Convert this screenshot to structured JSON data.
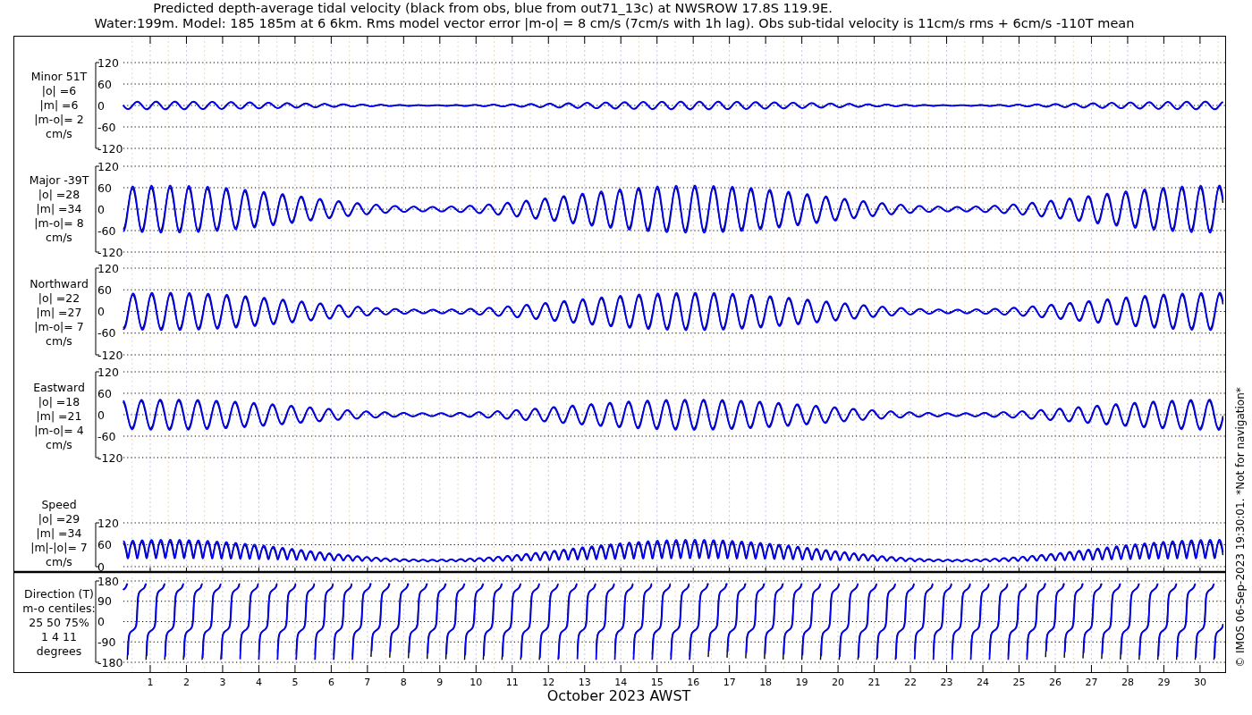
{
  "title_lines": [
    "Predicted depth-average tidal velocity (black from obs, blue from out71_13c) at NWSROW 17.8S 119.9E.",
    "Water:199m. Model: 185 185m at 6 6km. Rms model vector error |m-o| = 8 cm/s (7cm/s with 1h lag). Obs sub-tidal velocity is 11cm/s rms + 6cm/s -110T mean"
  ],
  "panels": [
    {
      "kind": "minor",
      "label_lines": [
        "Minor 51T",
        "|o| =6",
        "|m| =6",
        "|m-o|= 2",
        "cm/s"
      ],
      "yticks": [
        "120",
        "60",
        "0",
        "-60",
        "-120"
      ]
    },
    {
      "kind": "major",
      "label_lines": [
        "Major -39T",
        "|o| =28",
        "|m| =34",
        "|m-o|= 8",
        "cm/s"
      ],
      "yticks": [
        "120",
        "60",
        "0",
        "-60",
        "-120"
      ]
    },
    {
      "kind": "north",
      "label_lines": [
        "Northward",
        "|o| =22",
        "|m| =27",
        "|m-o|= 7",
        "cm/s"
      ],
      "yticks": [
        "120",
        "60",
        "0",
        "-60",
        "-120"
      ]
    },
    {
      "kind": "east",
      "label_lines": [
        "Eastward",
        "|o| =18",
        "|m| =21",
        "|m-o|= 4",
        "cm/s"
      ],
      "yticks": [
        "120",
        "60",
        "0",
        "-60",
        "-120"
      ]
    },
    {
      "kind": "speed",
      "label_lines": [
        "Speed",
        "|o| =29",
        "|m| =34",
        "|m|-|o|= 7",
        "cm/s"
      ],
      "yticks": [
        "120",
        "60",
        "0"
      ]
    },
    {
      "kind": "direction",
      "label_lines": [
        "Direction (T)",
        "m-o centiles:",
        "25  50  75%",
        "1    4   11",
        "degrees"
      ],
      "yticks": [
        "180",
        "90",
        "0",
        "-90",
        "-180"
      ]
    }
  ],
  "xticks": [
    "1",
    "2",
    "3",
    "4",
    "5",
    "6",
    "7",
    "8",
    "9",
    "10",
    "11",
    "12",
    "13",
    "14",
    "15",
    "16",
    "17",
    "18",
    "19",
    "20",
    "21",
    "22",
    "23",
    "24",
    "25",
    "26",
    "27",
    "28",
    "29",
    "30"
  ],
  "xlabel": "October 2023 AWST",
  "credit": "© IMOS 06-Sep-2023 19:30:01. *Not for navigation*"
}
